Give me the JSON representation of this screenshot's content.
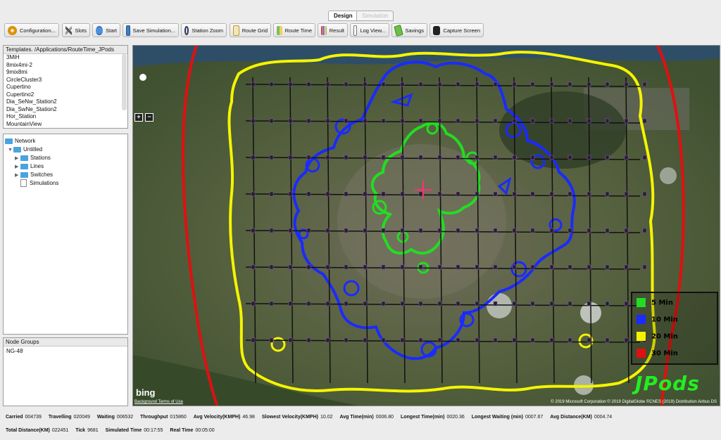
{
  "tabs": {
    "design": "Design",
    "simulation": "Simulation"
  },
  "toolbar": {
    "configuration": "Configuration...",
    "slots": "Slots",
    "start": "Start",
    "save_simulation": "Save Simulation...",
    "station_zoom": "Station Zoom",
    "route_grid": "Route Grid",
    "route_time": "Route Time",
    "result": "Result",
    "log_view": "Log View...",
    "savings": "Savings",
    "capture_screen": "Capture Screen"
  },
  "templates": {
    "title": "Templates. /Applications/RouteTime_JPods",
    "items": [
      "3MiH",
      "8mix4mi-2",
      "9mix8mi",
      "CircleCluster3",
      "Cupertino",
      "Cupertino2",
      "Dia_SeNw_Station2",
      "Dia_SwNe_Station2",
      "Hor_Station",
      "MountainView"
    ]
  },
  "network": {
    "root": "Network",
    "untitled": "Untitled",
    "stations": "Stations",
    "lines": "Lines",
    "switches": "Switches",
    "simulations": "Simulations"
  },
  "node_groups": {
    "title": "Node Groups",
    "items": [
      "NG-48"
    ]
  },
  "map": {
    "legend": [
      "5 Min",
      "10 Min",
      "20 Min",
      "30 Min"
    ],
    "legend_colors": [
      "#22dd22",
      "#1a2bff",
      "#f4f400",
      "#e01010"
    ],
    "brand": "JPods",
    "bing": "bing",
    "terms": "Background Terms of Use",
    "copyright": "© 2019 Microsoft Corporation © 2019 DigitalGlobe ©CNES (2019) Distribution Airbus DS"
  },
  "status": {
    "carried_label": "Carried",
    "carried": "004739",
    "travelling_label": "Travelling",
    "travelling": "020049",
    "waiting_label": "Waiting",
    "waiting": "006532",
    "throughput_label": "Throughput",
    "throughput": "015860",
    "avg_velocity_label": "Avg Velocity(KMPH)",
    "avg_velocity": "46.98",
    "slowest_velocity_label": "Slowest Velocity(KMPH)",
    "slowest_velocity": "10.02",
    "avg_time_label": "Avg Time(min)",
    "avg_time": "0006.80",
    "longest_time_label": "Longest Time(min)",
    "longest_time": "0020.36",
    "longest_waiting_label": "Longest Waiting (min)",
    "longest_waiting": "0007.67",
    "avg_distance_label": "Avg Distance(KM)",
    "avg_distance": "0004.74",
    "total_distance_label": "Total Distance(KM)",
    "total_distance": "022451",
    "tick_label": "Tick",
    "tick": "9681",
    "simulated_time_label": "Simulated Time",
    "simulated_time": "00:17:55",
    "real_time_label": "Real Time",
    "real_time": "00:05:00"
  }
}
